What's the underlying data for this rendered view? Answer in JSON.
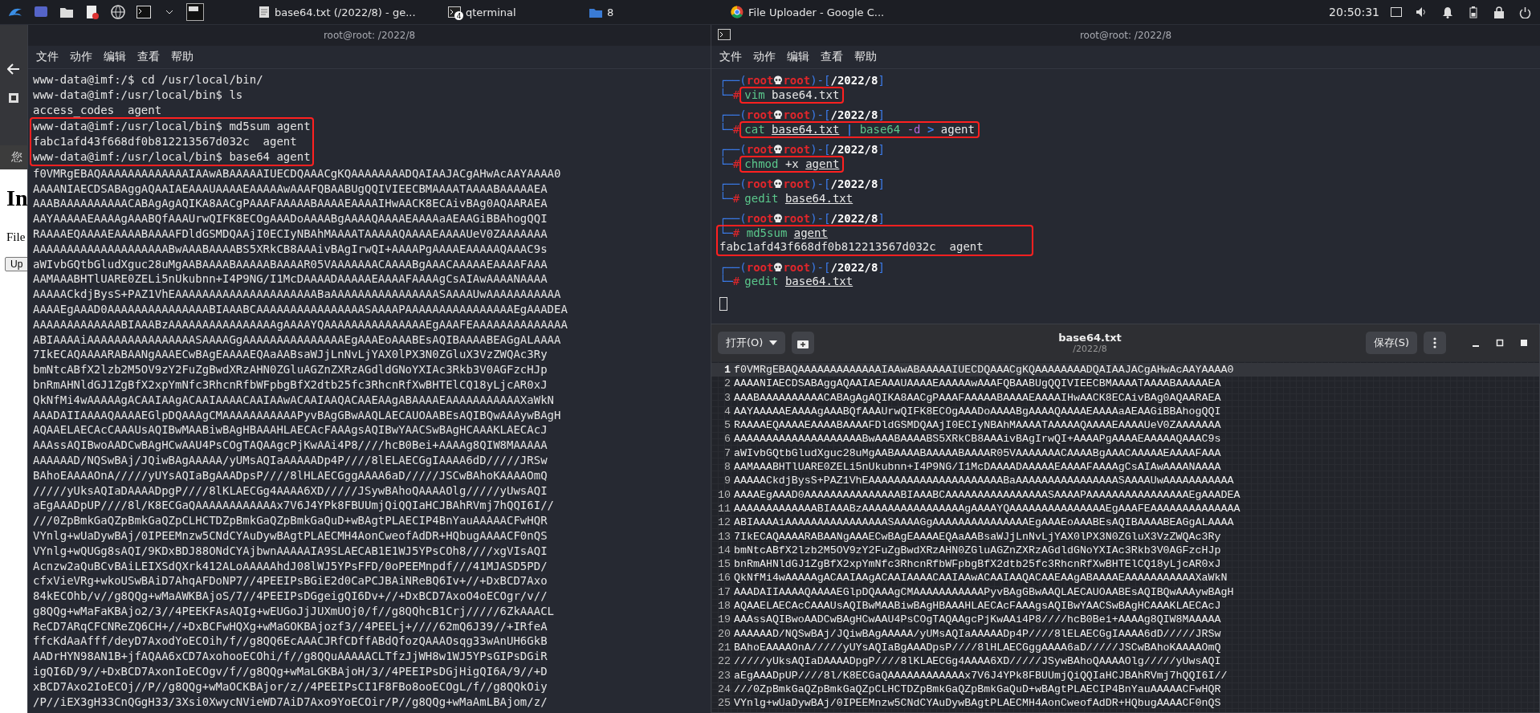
{
  "taskbar": {
    "tasks": [
      {
        "kind": "editor",
        "label": "base64.txt (/2022/8) - ge..."
      },
      {
        "kind": "terminal",
        "label": "qterminal",
        "badge": "4"
      },
      {
        "kind": "folder",
        "label": "8"
      },
      {
        "kind": "browser",
        "label": "File Uploader - Google C..."
      }
    ],
    "clock": "20:50:31"
  },
  "browser": {
    "notice": "您",
    "heading": "In",
    "label": "File",
    "button": "Up"
  },
  "left_terminal": {
    "title": "root@root: /2022/8",
    "menu": [
      "文件",
      "动作",
      "编辑",
      "查看",
      "帮助"
    ],
    "blocks": [
      {
        "highlighted": false,
        "lines": [
          "www-data@imf:/$ cd /usr/local/bin/",
          "www-data@imf:/usr/local/bin$ ls",
          "access_codes  agent"
        ]
      },
      {
        "highlighted": true,
        "lines": [
          "www-data@imf:/usr/local/bin$ md5sum agent",
          "fabc1afd43f668df0b812213567d032c  agent",
          "www-data@imf:/usr/local/bin$ base64 agent"
        ]
      },
      {
        "highlighted": false,
        "lines": [
          "f0VMRgEBAQAAAAAAAAAAAAAIAAwABAAAAAIUECDQAAACgKQAAAAAAAADQAIAAJACgAHwAcAAYAAAA0",
          "AAAANIAECDSABAggAQAAIAEAAAUAAAAEAAAAAwAAAFQBAABUgQQIVIEECBMAAAATAAAABAAAAAEA",
          "AAABAAAAAAAAAACABAgAgAQIKA8AACgPAAAFAAAAABAAAAEAAAAIHwAACK8ECAivBAg0AQAARAEA",
          "AAYAAAAAEAAAAgAAABQfAAAUrwQIFK8ECOgAAADoAAAABgAAAAQAAAAEAAAAaAEAAGiBBAhogQQI",
          "RAAAAEQAAAAEAAAABAAAAFDldGSMDQAAjI0ECIyNBAhMAAAATAAAAAQAAAAEAAAAUeV0ZAAAAAAA",
          "AAAAAAAAAAAAAAAAAAAABwAAABAAAABS5XRkCB8AAAivBAgIrwQI+AAAAPgAAAAEAAAAAQAAAC9s",
          "aWIvbGQtbGludXguc28uMgAABAAAABAAAAABAAAAR05VAAAAAAACAAAABgAAACAAAAAEAAAAFAAA",
          "AAMAAABHTlUARE0ZELi5nUkubnn+I4P9NG/I1McDAAAADAAAAAEAAAAFAAAAgCsAIAwAAAANAAAA",
          "AAAAACkdjBysS+PAZ1VhEAAAAAAAAAAAAAAAAAAAAABaAAAAAAAAAAAAAAAASAAAAUwAAAAAAAAAAA",
          "AAAAEgAAAD0AAAAAAAAAAAAAAABIAAABCAAAAAAAAAAAAAAAASAAAAPAAAAAAAAAAAAAAAAEgAAADEA",
          "AAAAAAAAAAAAABIAAABzAAAAAAAAAAAAAAAAgAAAAYQAAAAAAAAAAAAAAAEgAAAFEAAAAAAAAAAAAAA",
          "ABIAAAAiAAAAAAAAAAAAAAAASAAAAGgAAAAAAAAAAAAAAAEgAAAEoAAABEsAQIBAAAABEAGgALAAAA",
          "7IkECAQAAAARABAANgAAAECwBAgEAAAAEQAaAABsaWJjLnNvLjYAX0lPX3N0ZGluX3VzZWQAc3Ry",
          "bmNtcABfX2lzb2M5OV9zY2FuZgBwdXRzAHN0ZGluAGZnZXRzAGdldGNoYXIAc3Rkb3V0AGFzcHJp",
          "bnRmAHNldGJ1ZgBfX2xpYmNfc3RhcnRfbWFpbgBfX2dtb25fc3RhcnRfXwBHTElCQ18yLjcAR0xJ",
          "QkNfMi4wAAAAAgACAAIAAgACAAIAAAACAAIAAwACAAIAAQACAAEAAgABAAAAEAAAAAAAAAAAXaWkN",
          "AAADAIIAAAAQAAAAEGlpDQAAAgCMAAAAAAAAAAAPyvBAgGBwAAQLAECAUOAABEsAQIBQwAAAywBAgH",
          "AQAAELAECAcCAAAUsAQIBwMAABiwBAgHBAAAHLAECAcFAAAgsAQIBwYAACSwBAgHCAAAKLAECAcJ",
          "AAAssAQIBwoAADCwBAgHCwAAU4PsCOgTAQAAgcPjKwAAi4P8////hcB0Bei+AAAAg8QIW8MAAAAA",
          "AAAAAAD/NQSwBAj/JQiwBAgAAAAA/yUMsAQIaAAAAADp4P////8lELAECGgIAAAA6dD/////JRSw",
          "BAhoEAAAAOnA/////yUYsAQIaBgAAADpsP////8lHLAECGggAAAA6aD/////JSCwBAhoKAAAAOmQ",
          "/////yUksAQIaDAAAADpgP////8lKLAECGg4AAAA6XD/////JSywBAhoQAAAAOlg/////yUwsAQI",
          "aEgAAADpUP////8l/K8ECGaQAAAAAAAAAAAAx7V6J4YPk8FBUUmjQiQQIaHCJBAhRVmj7hQQI6I//",
          "///0ZpBmkGaQZpBmkGaQZpCLHCTDZpBmkGaQZpBmkGaQuD+wBAgtPLAECIP4BnYauAAAAACFwHQR",
          "VYnlg+wUaDywBAj/0IPEEMnzw5CNdCYAuDywBAgtPLAECMH4AonCweofAdDR+HQbugAAAACF0nQS",
          "VYnlg+wQUGg8sAQI/9KDxBDJ88ONdCYAjbwnAAAAAIA9SLAECAB1E1WJ5YPsCOh8////xgVIsAQI",
          "Acnzw2aQuBCvBAiLEIXSdQXrk412ALoAAAAAhdJ08lWJ5YPsFFD/0oPEEMnpdf///41MJASD5PD/",
          "cfxVieVRg+wkoUSwBAiD7AhqAFDoNP7//4PEEIPsBGiE2d0CaPCJBAiNReBQ6Iv+//+DxBCD7Axo",
          "84kECOhb/v//g8QQg+wMaAWKBAjoS/7//4PEEIPsDGgeigQI6Dv+//+DxBCD7AxoO4oECOgr/v//",
          "g8QQg+wMaFaKBAjo2/3//4PEEKFAsAQIg+wEUGoJjJUXmUOj0/f//g8QQhcB1Crj/////6ZkAAACL",
          "ReCD7ARqCFCNReZQ6CH+//+DxBCFwHQXg+wMaGOKBAjozf3//4PEELj+////62mQ6J39//+IRfeA",
          "ffcKdAaAfff/deyD7AxodYoECOih/f//g8QQ6EcAAACJRfCDffABdQfozQAAAOsqg33wAnUH6GkB",
          "AADrHYN98AN1B+jfAQAA6xCD7AxohooECOhi/f//g8QQuAAAAACLTfzJjWH8w1WJ5YPsGIPsDGiR",
          "igQI6D/9//+DxBCD7AxonIoECOgv/f//g8QQg+wMaLGKBAjoH/3//4PEEIPsDGjHigQI6A/9//+D",
          "xBCD7Axo2IoECOj//P//g8QQg+wMaOCKBAjor/z//4PEEIPsCI1F8FBo8ooECOgL/f//g8QQkOiy",
          "/P//iEX3gH33CnQGgH33/3Xsi0XwycNVieWD7AiD7Axo9YoECOir/P//g8QQg+wMaAmLBAjom/z/"
        ]
      }
    ]
  },
  "right_terminal": {
    "title": "root@root: /2022/8",
    "menu": [
      "文件",
      "动作",
      "编辑",
      "查看",
      "帮助"
    ],
    "entries": [
      {
        "highlighted": true,
        "prompt": [
          {
            "kind": "frame",
            "text": "┌──("
          },
          {
            "kind": "user",
            "text": "root"
          },
          {
            "kind": "skull"
          },
          {
            "kind": "user",
            "text": "root"
          },
          {
            "kind": "frame",
            "text": ")-["
          },
          {
            "kind": "dir",
            "text": "/2022/8"
          },
          {
            "kind": "frame",
            "text": "]"
          }
        ],
        "lead": [
          {
            "kind": "frame",
            "text": "└─"
          },
          {
            "kind": "hash",
            "text": "#"
          }
        ],
        "command": [
          {
            "kind": "cmd",
            "text": "vim"
          },
          {
            "kind": "arg",
            "text": "base64.txt"
          }
        ]
      },
      {
        "highlighted": true,
        "prompt": [
          {
            "kind": "frame",
            "text": "┌──("
          },
          {
            "kind": "user",
            "text": "root"
          },
          {
            "kind": "skull"
          },
          {
            "kind": "user",
            "text": "root"
          },
          {
            "kind": "frame",
            "text": ")-["
          },
          {
            "kind": "dir",
            "text": "/2022/8"
          },
          {
            "kind": "frame",
            "text": "]"
          }
        ],
        "lead": [
          {
            "kind": "frame",
            "text": "└─"
          },
          {
            "kind": "hash",
            "text": "#"
          }
        ],
        "command": [
          {
            "kind": "cmd",
            "text": "cat"
          },
          {
            "kind": "path",
            "text": "base64.txt"
          },
          {
            "kind": "op",
            "text": "|"
          },
          {
            "kind": "cmd",
            "text": "base64"
          },
          {
            "kind": "flag",
            "text": "-d"
          },
          {
            "kind": "op",
            "text": ">"
          },
          {
            "kind": "arg",
            "text": "agent"
          }
        ]
      },
      {
        "highlighted": true,
        "prompt": [
          {
            "kind": "frame",
            "text": "┌──("
          },
          {
            "kind": "user",
            "text": "root"
          },
          {
            "kind": "skull"
          },
          {
            "kind": "user",
            "text": "root"
          },
          {
            "kind": "frame",
            "text": ")-["
          },
          {
            "kind": "dir",
            "text": "/2022/8"
          },
          {
            "kind": "frame",
            "text": "]"
          }
        ],
        "lead": [
          {
            "kind": "frame",
            "text": "└─"
          },
          {
            "kind": "hash",
            "text": "#"
          }
        ],
        "command": [
          {
            "kind": "cmd",
            "text": "chmod"
          },
          {
            "kind": "arg",
            "text": "+x"
          },
          {
            "kind": "path",
            "text": "agent"
          }
        ]
      },
      {
        "highlighted": false,
        "prompt": [
          {
            "kind": "frame",
            "text": "┌──("
          },
          {
            "kind": "user",
            "text": "root"
          },
          {
            "kind": "skull"
          },
          {
            "kind": "user",
            "text": "root"
          },
          {
            "kind": "frame",
            "text": ")-["
          },
          {
            "kind": "dir",
            "text": "/2022/8"
          },
          {
            "kind": "frame",
            "text": "]"
          }
        ],
        "lead": [
          {
            "kind": "frame",
            "text": "└─"
          },
          {
            "kind": "hash",
            "text": "#"
          }
        ],
        "command": [
          {
            "kind": "cmd",
            "text": "gedit"
          },
          {
            "kind": "path",
            "text": "base64.txt"
          }
        ]
      },
      {
        "highlighted": true,
        "prompt": [
          {
            "kind": "frame",
            "text": "┌──("
          },
          {
            "kind": "user",
            "text": "root"
          },
          {
            "kind": "skull"
          },
          {
            "kind": "user",
            "text": "root"
          },
          {
            "kind": "frame",
            "text": ")-["
          },
          {
            "kind": "dir",
            "text": "/2022/8"
          },
          {
            "kind": "frame",
            "text": "]"
          }
        ],
        "lead": [
          {
            "kind": "frame",
            "text": "└─"
          },
          {
            "kind": "hash",
            "text": "#"
          }
        ],
        "command": [
          {
            "kind": "cmd",
            "text": "md5sum"
          },
          {
            "kind": "path",
            "text": "agent"
          }
        ],
        "output": [
          "fabc1afd43f668df0b812213567d032c  agent"
        ]
      },
      {
        "highlighted": false,
        "prompt": [
          {
            "kind": "frame",
            "text": "┌──("
          },
          {
            "kind": "user",
            "text": "root"
          },
          {
            "kind": "skull"
          },
          {
            "kind": "user",
            "text": "root"
          },
          {
            "kind": "frame",
            "text": ")-["
          },
          {
            "kind": "dir",
            "text": "/2022/8"
          },
          {
            "kind": "frame",
            "text": "]"
          }
        ],
        "lead": [
          {
            "kind": "frame",
            "text": "└─"
          },
          {
            "kind": "hash",
            "text": "#"
          }
        ],
        "command": [
          {
            "kind": "cmd",
            "text": "gedit"
          },
          {
            "kind": "path",
            "text": "base64.txt"
          }
        ]
      }
    ]
  },
  "gedit": {
    "open_button": "打开(O)",
    "title": "base64.txt",
    "subtitle": "/2022/8",
    "save_button": "保存(S)",
    "lines": [
      {
        "number": "1",
        "current": true,
        "text": "f0VMRgEBAQAAAAAAAAAAAAAIAAwABAAAAAIUECDQAAACgKQAAAAAAAADQAIAAJACgAHwAcAAYAAAA0"
      },
      {
        "number": "2",
        "current": false,
        "text": "AAAANIAECDSABAggAQAAIAEAAAUAAAAEAAAAAwAAAFQBAABUgQQIVIEECBMAAAATAAAABAAAAAEA"
      },
      {
        "number": "3",
        "current": false,
        "text": "AAABAAAAAAAAAACABAgAgAQIKA8AACgPAAAFAAAAABAAAAEAAAAIHwAACK8ECAivBAg0AQAARAEA"
      },
      {
        "number": "4",
        "current": false,
        "text": "AAYAAAAAEAAAAgAAABQfAAAUrwQIFK8ECOgAAADoAAAABgAAAAQAAAAEAAAAaAEAAGiBBAhogQQI"
      },
      {
        "number": "5",
        "current": false,
        "text": "RAAAAEQAAAAEAAAABAAAAFDldGSMDQAAjI0ECIyNBAhMAAAATAAAAAQAAAAEAAAAUeV0ZAAAAAAA"
      },
      {
        "number": "6",
        "current": false,
        "text": "AAAAAAAAAAAAAAAAAAAABwAAABAAAABS5XRkCB8AAAivBAgIrwQI+AAAAPgAAAAEAAAAAQAAAC9s"
      },
      {
        "number": "7",
        "current": false,
        "text": "aWIvbGQtbGludXguc28uMgAABAAAABAAAAABAAAAR05VAAAAAAACAAAABgAAACAAAAAEAAAAFAAA"
      },
      {
        "number": "8",
        "current": false,
        "text": "AAMAAABHTlUARE0ZELi5nUkubnn+I4P9NG/I1McDAAAADAAAAAEAAAAFAAAAgCsAIAwAAAANAAAA"
      },
      {
        "number": "9",
        "current": false,
        "text": "AAAAACkdjBysS+PAZ1VhEAAAAAAAAAAAAAAAAAAAAABaAAAAAAAAAAAAAAAASAAAAUwAAAAAAAAAAA"
      },
      {
        "number": "10",
        "current": false,
        "text": "AAAAEgAAAD0AAAAAAAAAAAAAAABIAAABCAAAAAAAAAAAAAAAASAAAAPAAAAAAAAAAAAAAAAEgAAADEA"
      },
      {
        "number": "11",
        "current": false,
        "text": "AAAAAAAAAAAAABIAAABzAAAAAAAAAAAAAAAAgAAAAYQAAAAAAAAAAAAAAAEgAAAFEAAAAAAAAAAAAAA"
      },
      {
        "number": "12",
        "current": false,
        "text": "ABIAAAAiAAAAAAAAAAAAAAAASAAAAGgAAAAAAAAAAAAAAAEgAAAEoAAABEsAQIBAAAABEAGgALAAAA"
      },
      {
        "number": "13",
        "current": false,
        "text": "7IkECAQAAAARABAANgAAAECwBAgEAAAAEQAaAABsaWJjLnNvLjYAX0lPX3N0ZGluX3VzZWQAc3Ry"
      },
      {
        "number": "14",
        "current": false,
        "text": "bmNtcABfX2lzb2M5OV9zY2FuZgBwdXRzAHN0ZGluAGZnZXRzAGdldGNoYXIAc3Rkb3V0AGFzcHJp"
      },
      {
        "number": "15",
        "current": false,
        "text": "bnRmAHNldGJ1ZgBfX2xpYmNfc3RhcnRfbWFpbgBfX2dtb25fc3RhcnRfXwBHTElCQ18yLjcAR0xJ"
      },
      {
        "number": "16",
        "current": false,
        "text": "QkNfMi4wAAAAAgACAAIAAgACAAIAAAACAAIAAwACAAIAAQACAAEAAgABAAAAEAAAAAAAAAAAXaWkN"
      },
      {
        "number": "17",
        "current": false,
        "text": "AAADAIIAAAAQAAAAEGlpDQAAAgCMAAAAAAAAAAAPyvBAgGBwAAQLAECAUOAABEsAQIBQwAAAywBAgH"
      },
      {
        "number": "18",
        "current": false,
        "text": "AQAAELAECAcCAAAUsAQIBwMAABiwBAgHBAAAHLAECAcFAAAgsAQIBwYAACSwBAgHCAAAKLAECAcJ"
      },
      {
        "number": "19",
        "current": false,
        "text": "AAAssAQIBwoAADCwBAgHCwAAU4PsCOgTAQAAgcPjKwAAi4P8////hcB0Bei+AAAAg8QIW8MAAAAA"
      },
      {
        "number": "20",
        "current": false,
        "text": "AAAAAAD/NQSwBAj/JQiwBAgAAAAA/yUMsAQIaAAAAADp4P////8lELAECGgIAAAA6dD/////JRSw"
      },
      {
        "number": "21",
        "current": false,
        "text": "BAhoEAAAAOnA/////yUYsAQIaBgAAADpsP////8lHLAECGggAAAA6aD/////JSCwBAhoKAAAAOmQ"
      },
      {
        "number": "22",
        "current": false,
        "text": "/////yUksAQIaDAAAADpgP////8lKLAECGg4AAAA6XD/////JSywBAhoQAAAAOlg/////yUwsAQI"
      },
      {
        "number": "23",
        "current": false,
        "text": "aEgAAADpUP////8l/K8ECGaQAAAAAAAAAAAAx7V6J4YPk8FBUUmjQiQQIaHCJBAhRVmj7hQQI6I//"
      },
      {
        "number": "24",
        "current": false,
        "text": "///0ZpBmkGaQZpBmkGaQZpCLHCTDZpBmkGaQZpBmkGaQuD+wBAgtPLAECIP4BnYauAAAAACFwHQR"
      },
      {
        "number": "25",
        "current": false,
        "text": "VYnlg+wUaDywBAj/0IPEEMnzw5CNdCYAuDywBAgtPLAECMH4AonCweofAdDR+HQbugAAAACF0nQS"
      }
    ]
  }
}
